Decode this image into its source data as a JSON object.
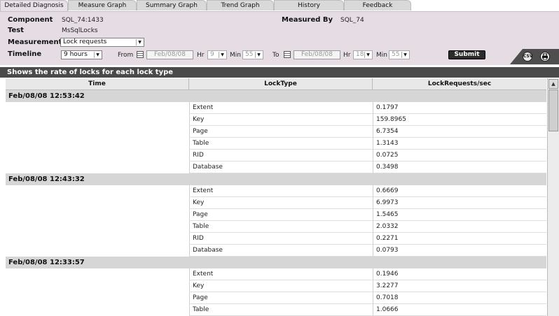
{
  "tabs": [
    {
      "label": "Detailed Diagnosis",
      "active": true
    },
    {
      "label": "Measure Graph",
      "active": false
    },
    {
      "label": "Summary Graph",
      "active": false
    },
    {
      "label": "Trend Graph",
      "active": false
    },
    {
      "label": "History",
      "active": false
    },
    {
      "label": "Feedback",
      "active": false
    }
  ],
  "form": {
    "component_label": "Component",
    "component_value": "SQL_74:1433",
    "test_label": "Test",
    "test_value": "MsSqlLocks",
    "measured_by_label": "Measured By",
    "measured_by_value": "SQL_74",
    "measurement_label": "Measurement",
    "measurement_value": "Lock requests",
    "timeline_label": "Timeline",
    "timeline_value": "9 hours",
    "from_label": "From",
    "from_date": "Feb/08/08",
    "to_label": "To",
    "to_date": "Feb/08/08",
    "hr_label": "Hr",
    "min_label": "Min",
    "from_hr": "9",
    "from_min": "55",
    "to_hr": "18",
    "to_min": "55",
    "submit_label": "Submit"
  },
  "icons": {
    "csv": "csv-icon",
    "print": "print-icon",
    "csv_text": "CSV"
  },
  "title": "Shows the rate of locks for each lock type",
  "table": {
    "columns": [
      "Time",
      "LockType",
      "LockRequests/sec"
    ],
    "groups": [
      {
        "time": "Feb/08/08 12:53:42",
        "rows": [
          [
            "Extent",
            "0.1797"
          ],
          [
            "Key",
            "159.8965"
          ],
          [
            "Page",
            "6.7354"
          ],
          [
            "Table",
            "1.3143"
          ],
          [
            "RID",
            "0.0725"
          ],
          [
            "Database",
            "0.3498"
          ]
        ]
      },
      {
        "time": "Feb/08/08 12:43:32",
        "rows": [
          [
            "Extent",
            "0.6669"
          ],
          [
            "Key",
            "6.9973"
          ],
          [
            "Page",
            "1.5465"
          ],
          [
            "Table",
            "2.0332"
          ],
          [
            "RID",
            "0.2271"
          ],
          [
            "Database",
            "0.0793"
          ]
        ]
      },
      {
        "time": "Feb/08/08 12:33:57",
        "rows": [
          [
            "Extent",
            "0.1946"
          ],
          [
            "Key",
            "3.2277"
          ],
          [
            "Page",
            "0.7018"
          ],
          [
            "Table",
            "1.0666"
          ]
        ]
      }
    ]
  }
}
